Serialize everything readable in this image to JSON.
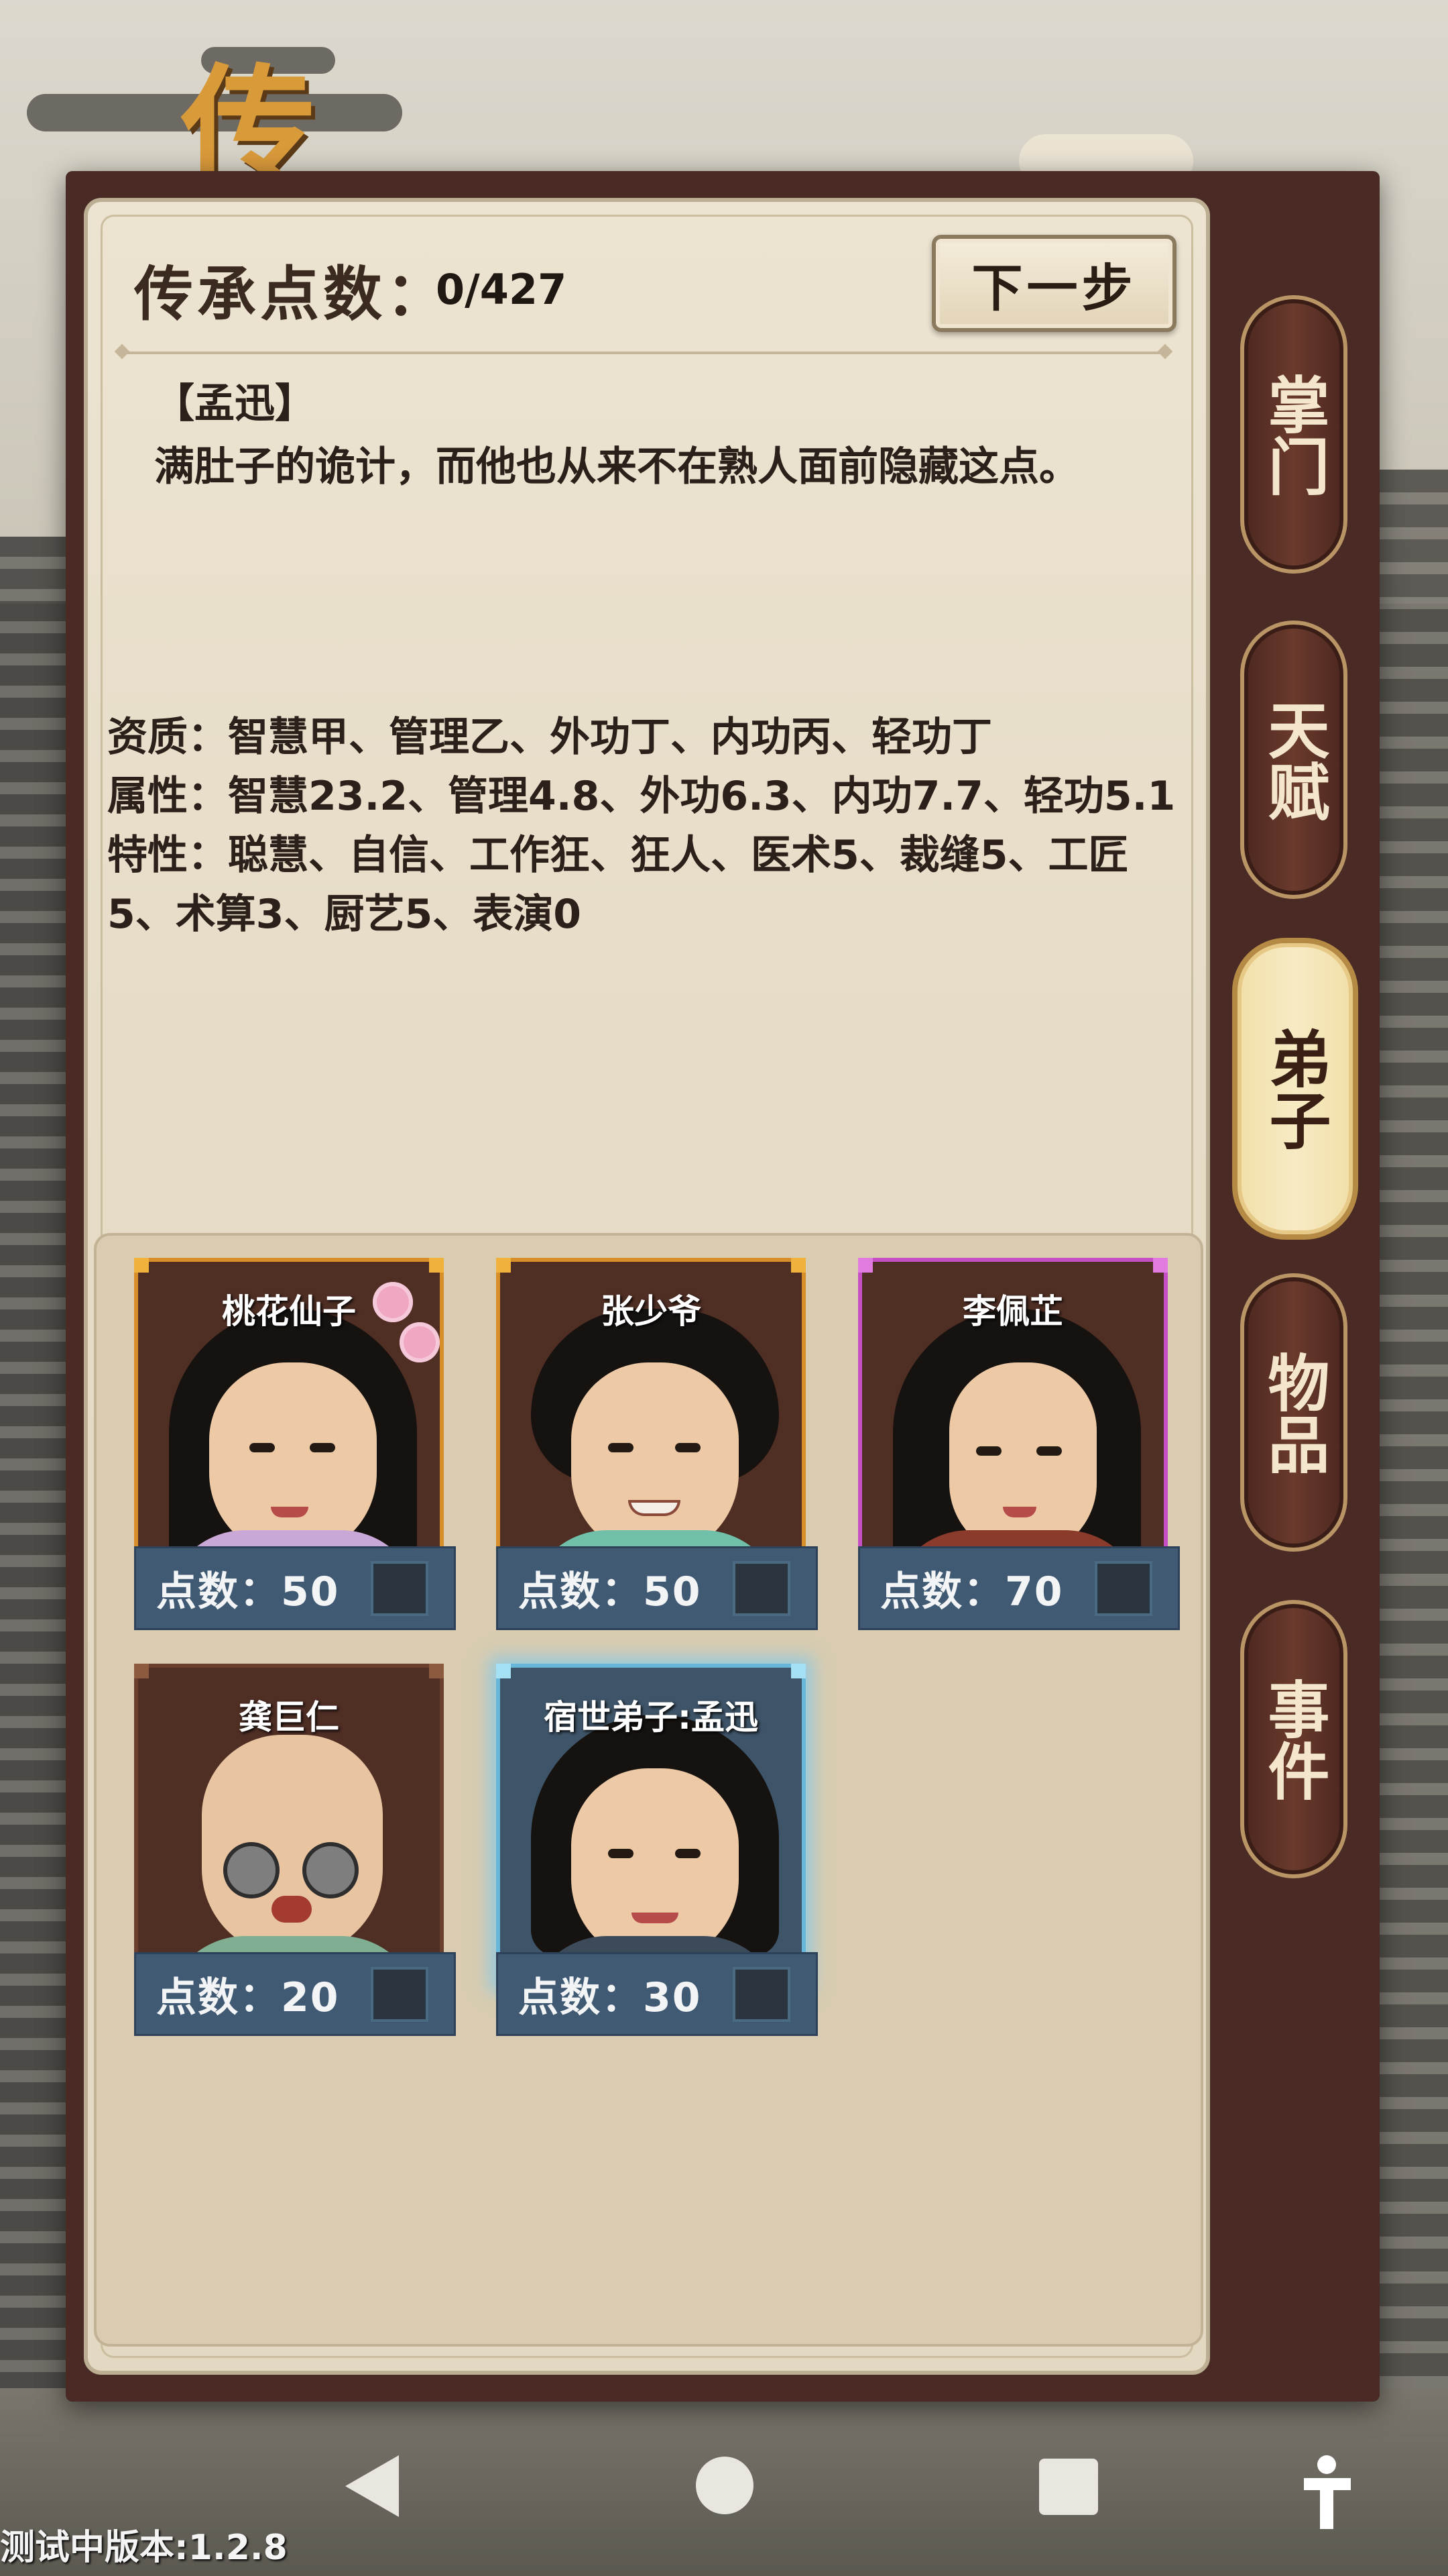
{
  "header": {
    "points_label": "传承点数：",
    "points_value": "0/427",
    "next_button": "下一步",
    "banner_title": "传承"
  },
  "description": {
    "name": "【孟迅】",
    "text": "满肚子的诡计，而他也从来不在熟人面前隐藏这点。"
  },
  "info": {
    "aptitude": "资质：智慧甲、管理乙、外功丁、内功丙、轻功丁",
    "attributes": "属性：智慧23.2、管理4.8、外功6.3、内功7.7、轻功5.1",
    "traits": "特性：聪慧、自信、工作狂、狂人、医术5、裁缝5、工匠5、术算3、厨艺5、表演0"
  },
  "cards": [
    {
      "name": "桃花仙子",
      "points": "点数：50",
      "frame": "orange"
    },
    {
      "name": "张少爷",
      "points": "点数：50",
      "frame": "orange"
    },
    {
      "name": "李佩芷",
      "points": "点数：70",
      "frame": "purple"
    },
    {
      "name": "龚巨仁",
      "points": "点数：20",
      "frame": "brown"
    },
    {
      "name": "宿世弟子:孟迅",
      "points": "点数：30",
      "frame": "blue-selected"
    }
  ],
  "tabs": [
    {
      "label": "掌门",
      "active": false
    },
    {
      "label": "天赋",
      "active": false
    },
    {
      "label": "弟子",
      "active": true
    },
    {
      "label": "物品",
      "active": false
    },
    {
      "label": "事件",
      "active": false
    }
  ],
  "nav": {
    "icons": [
      "back-icon",
      "home-icon",
      "recent-apps-icon",
      "accessibility-icon"
    ]
  },
  "version": "测试中版本:1.2.8",
  "colors": {
    "panel": "#4a2a24",
    "paper": "#e6dcc7",
    "card_footer": "#415a73",
    "frame_orange": "#d88f2a",
    "frame_purple": "#c64fc6",
    "frame_selected": "#68b7d8",
    "tab_active": "#f7ebc4"
  }
}
